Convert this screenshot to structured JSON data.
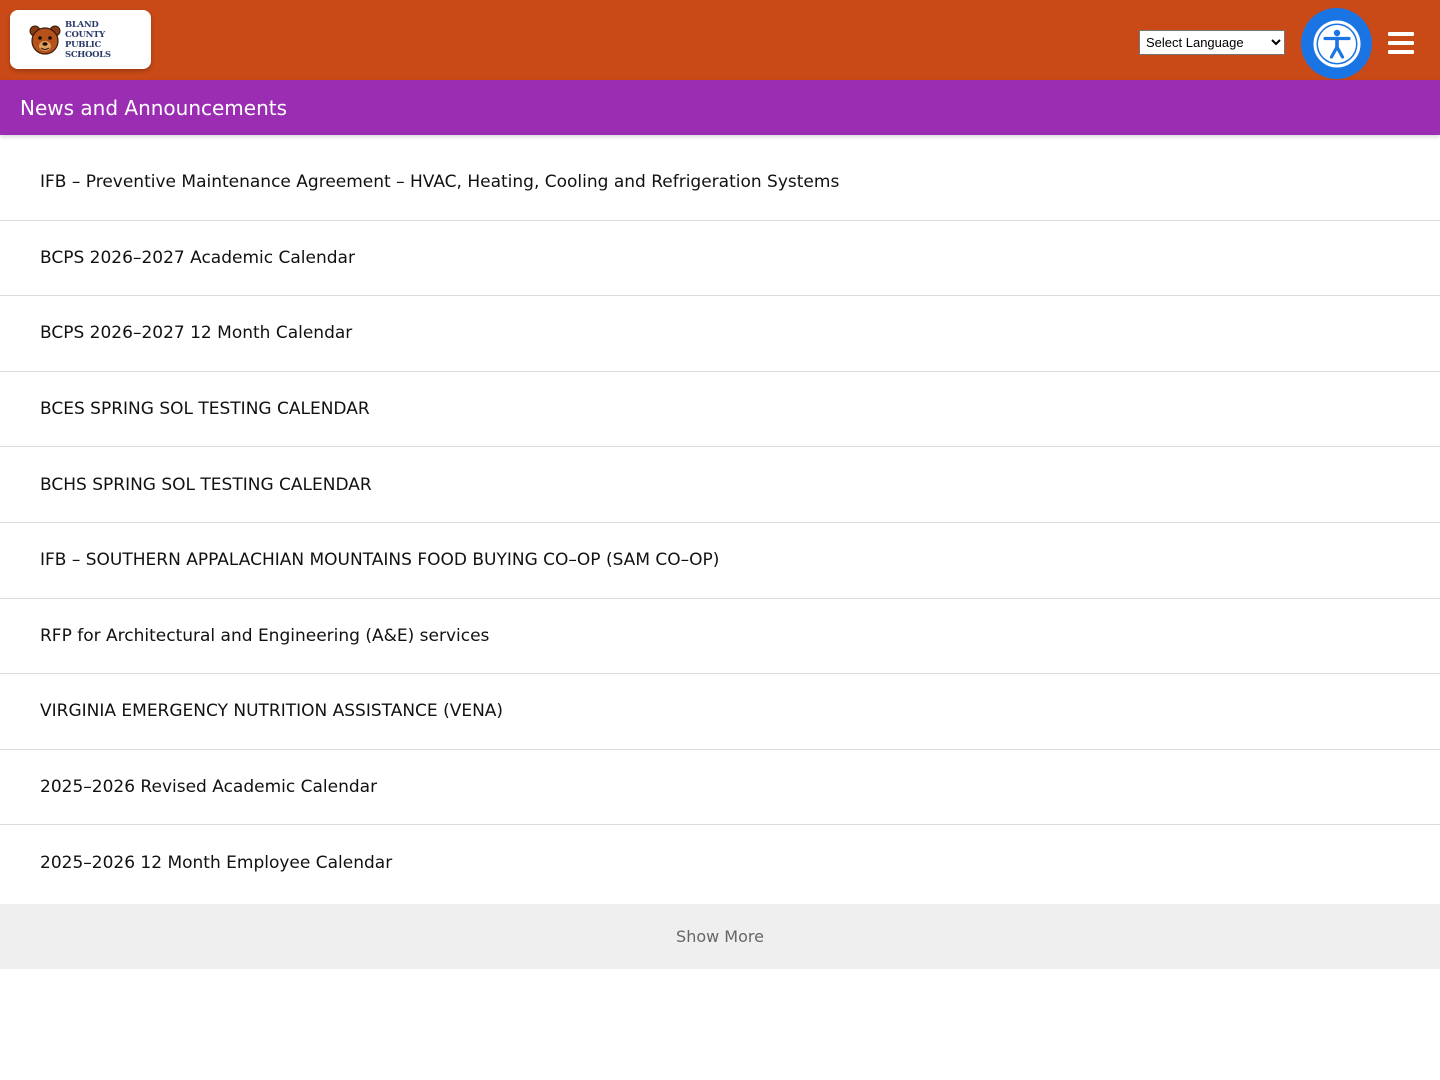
{
  "header": {
    "logo_text": "Bland County Public Schools",
    "logo_icon": "bear-mascot-icon",
    "language_select": {
      "selected": "Select Language",
      "options": [
        "Select Language"
      ]
    },
    "accessibility_icon": "accessibility-icon",
    "menu_icon": "hamburger-menu-icon",
    "colors": {
      "header_bg": "#c94a17",
      "accessibility_bg": "#1b74e4"
    }
  },
  "section": {
    "title": "News and Announcements",
    "color": "#9b2db3"
  },
  "news": [
    {
      "title": "IFB – Preventive Maintenance Agreement – HVAC, Heating, Cooling and Refrigeration Systems"
    },
    {
      "title": "BCPS 2026–2027 Academic Calendar"
    },
    {
      "title": "BCPS 2026–2027 12 Month Calendar"
    },
    {
      "title": "BCES SPRING SOL TESTING CALENDAR"
    },
    {
      "title": "BCHS SPRING SOL TESTING CALENDAR"
    },
    {
      "title": "IFB – SOUTHERN APPALACHIAN MOUNTAINS FOOD BUYING CO–OP (SAM CO–OP)"
    },
    {
      "title": "RFP for Architectural and Engineering (A&E) services"
    },
    {
      "title": "VIRGINIA EMERGENCY NUTRITION ASSISTANCE (VENA)"
    },
    {
      "title": "2025–2026 Revised Academic Calendar"
    },
    {
      "title": "2025–2026 12 Month Employee Calendar"
    }
  ],
  "show_more": {
    "label": "Show More"
  }
}
